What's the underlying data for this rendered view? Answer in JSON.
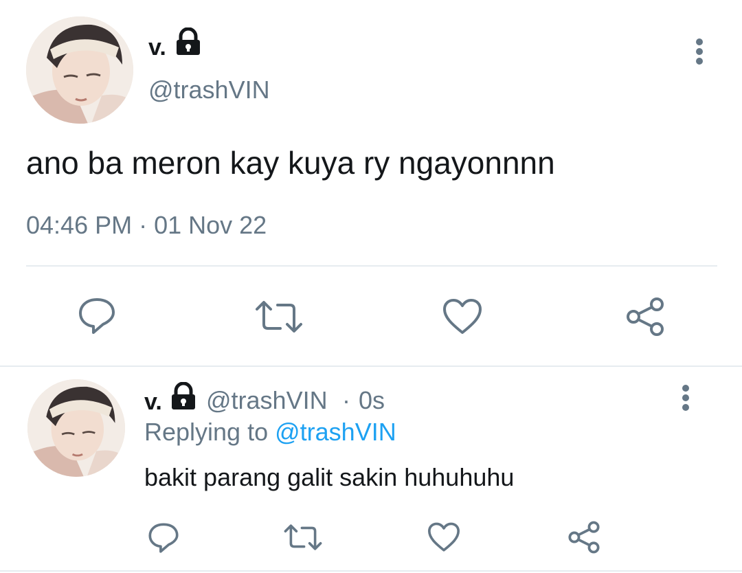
{
  "main_tweet": {
    "display_name": "v.",
    "handle": "@trashVIN",
    "text": "ano ba meron kay kuya ry ngayonnnn",
    "timestamp": "04:46 PM · 01 Nov 22",
    "icons": [
      "lock-icon",
      "more-vertical-icon",
      "reply-icon",
      "retweet-icon",
      "like-icon",
      "share-icon"
    ]
  },
  "reply_tweet": {
    "display_name": "v.",
    "handle": "@trashVIN",
    "separator": "·",
    "time_ago": "0s",
    "replying_prefix": "Replying to",
    "replying_handle": "@trashVIN",
    "text": "bakit parang galit sakin huhuhuhu",
    "icons": [
      "lock-icon",
      "more-vertical-icon",
      "reply-icon",
      "retweet-icon",
      "like-icon",
      "share-icon"
    ]
  },
  "colors": {
    "text": "#14171a",
    "secondary": "#657786",
    "accent": "#1da1f2",
    "divider": "#e6ecf0",
    "icon": "#657786"
  }
}
